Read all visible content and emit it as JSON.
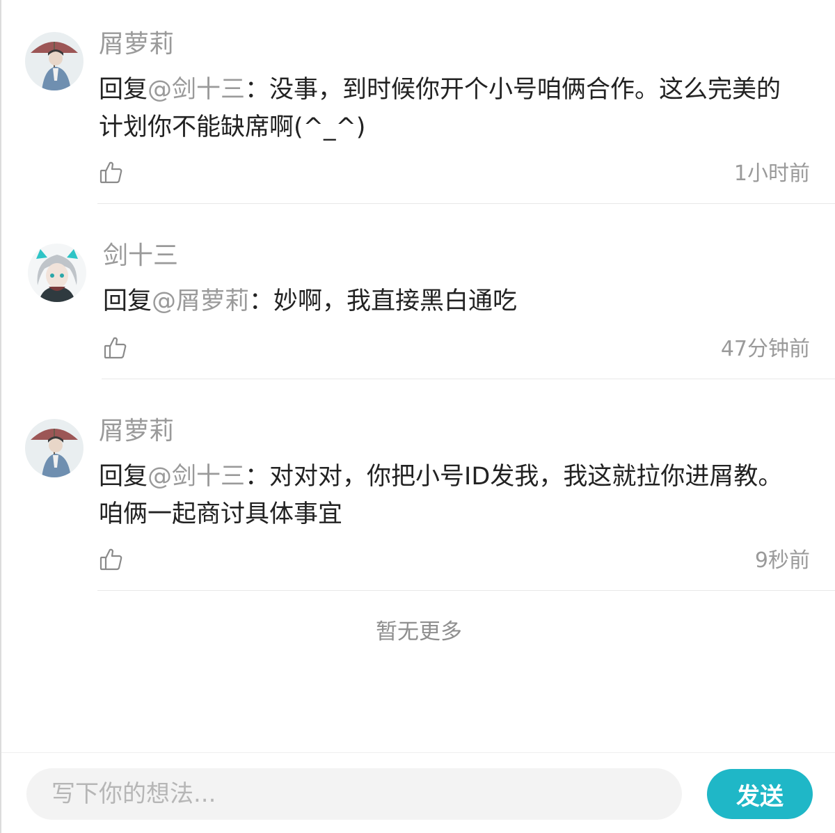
{
  "comments": [
    {
      "username": "屑萝莉",
      "reply_prefix": "回复",
      "mention": "@剑十三",
      "separator": "：",
      "text": "没事，到时候你开个小号咱俩合作。这么完美的计划你不能缺席啊(^_^)",
      "time": "1小时前",
      "avatar_icon": "avatar-man-umbrella"
    },
    {
      "username": "剑十三",
      "reply_prefix": "回复",
      "mention": "@屑萝莉",
      "separator": "：",
      "text": "妙啊，我直接黑白通吃",
      "time": "47分钟前",
      "avatar_icon": "avatar-anime-girl"
    },
    {
      "username": "屑萝莉",
      "reply_prefix": "回复",
      "mention": "@剑十三",
      "separator": "：",
      "text": "对对对，你把小号ID发我，我这就拉你进屑教。咱俩一起商讨具体事宜",
      "time": "9秒前",
      "avatar_icon": "avatar-man-umbrella"
    }
  ],
  "footer_text": "暂无更多",
  "input": {
    "placeholder": "写下你的想法..."
  },
  "send_label": "发送",
  "colors": {
    "accent": "#1fb7c7",
    "muted_text": "#9a9a9a",
    "body_text": "#222222"
  }
}
